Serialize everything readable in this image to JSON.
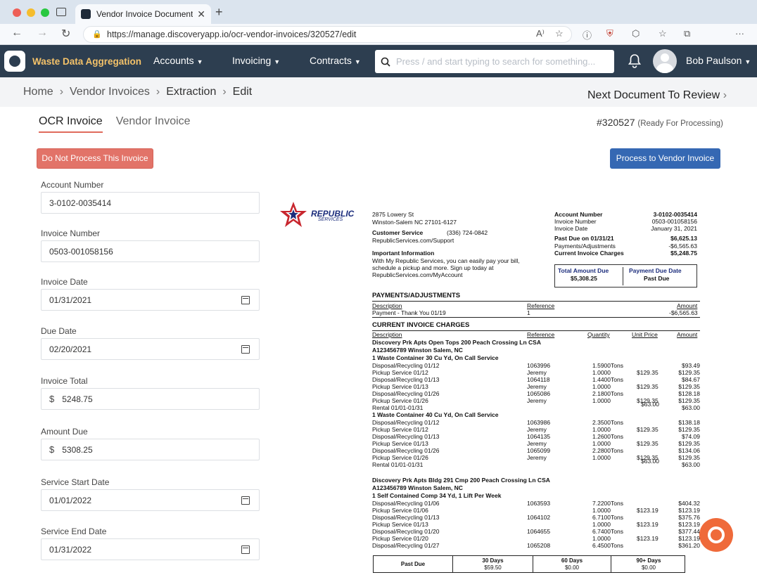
{
  "browser": {
    "tab_title": "Vendor Invoice Document Extr",
    "url": "https://manage.discoveryapp.io/ocr-vendor-invoices/320527/edit"
  },
  "app": {
    "brand": "Waste Data Aggregation",
    "menu": [
      "Accounts",
      "Invoicing",
      "Contracts"
    ],
    "search_placeholder": "Press / and start typing to search for something...",
    "user": "Bob Paulson"
  },
  "breadcrumb": [
    "Home",
    "Vendor Invoices",
    "Extraction",
    "Edit"
  ],
  "next_label": "Next Document To Review",
  "tabs": [
    "OCR Invoice",
    "Vendor Invoice"
  ],
  "doc_number": "#320527",
  "doc_status": "(Ready For Processing)",
  "buttons": {
    "reject": "Do Not Process This Invoice",
    "process": "Process to Vendor Invoice"
  },
  "fields": [
    {
      "label": "Account Number",
      "value": "3-0102-0035414"
    },
    {
      "label": "Invoice Number",
      "value": "0503-001058156"
    },
    {
      "label": "Invoice Date",
      "value": "01/31/2021"
    },
    {
      "label": "Due Date",
      "value": "02/20/2021"
    },
    {
      "label": "Invoice Total",
      "value": "5248.75",
      "currency": "$"
    },
    {
      "label": "Amount Due",
      "value": "5308.25",
      "currency": "$"
    },
    {
      "label": "Service Start Date",
      "value": "01/01/2022"
    },
    {
      "label": "Service End Date",
      "value": "01/31/2022"
    }
  ],
  "invoice": {
    "logo_name": "REPUBLIC",
    "logo_sub": "SERVICES",
    "address": [
      "2875 Lowery St",
      "Winston-Salem NC 27101-6127"
    ],
    "cs_label": "Customer Service",
    "cs_phone": "(336) 724-0842",
    "cs_url": "RepublicServices.com/Support",
    "info_title": "Important Information",
    "info_text": [
      "With My Republic Services, you can easily pay your bill,",
      "schedule a pickup and more. Sign up today at",
      "RepublicServices.com/MyAccount"
    ],
    "summary": [
      {
        "label": "Account Number",
        "value": "3-0102-0035414",
        "bold": true
      },
      {
        "label": "Invoice Number",
        "value": "0503-001058156",
        "bold": false
      },
      {
        "label": "Invoice Date",
        "value": "January 31, 2021",
        "bold": false
      },
      {
        "label": "Past Due on 01/31/21",
        "value": "$6,625.13",
        "bold": true
      },
      {
        "label": "Payments/Adjustments",
        "value": "-$6,565.63",
        "bold": false
      },
      {
        "label": "Current Invoice Charges",
        "value": "$5,248.75",
        "bold": true
      }
    ],
    "total_due_label": "Total Amount Due",
    "total_due_value": "$5,308.25",
    "pay_due_label": "Payment Due Date",
    "pay_due_value": "Past Due",
    "pay_adj_title": "PAYMENTS/ADJUSTMENTS",
    "pay_adj_headers": [
      "Description",
      "Reference",
      "Amount"
    ],
    "pay_adj_row": {
      "desc": "Payment - Thank You 01/19",
      "ref": "1",
      "amount": "-$6,565.63"
    },
    "charges_title": "CURRENT INVOICE CHARGES",
    "charges_headers": [
      "Description",
      "Reference",
      "Quantity",
      "Unit Price",
      "Amount"
    ],
    "groups": [
      {
        "site": "Discovery Prk Apts Open Tops  200 Peach Crossing Ln CSA",
        "acct": "A123456789 Winston Salem, NC",
        "blocks": [
          {
            "title": "1 Waste Container 30 Cu Yd, On Call Service",
            "rows": [
              [
                "Disposal/Recycling 01/12",
                "1063996",
                "1.5900Tons",
                "",
                "$93.49"
              ],
              [
                "Pickup Service 01/12",
                "Jeremy",
                "1.0000",
                "$129.35",
                "$129.35"
              ],
              [
                "Disposal/Recycling 01/13",
                "1064118",
                "1.4400Tons",
                "",
                "$84.67"
              ],
              [
                "Pickup Service 01/13",
                "Jeremy",
                "1.0000",
                "$129.35",
                "$129.35"
              ],
              [
                "Disposal/Recycling 01/26",
                "1065086",
                "2.1800Tons",
                "",
                "$128.18"
              ],
              [
                "Pickup Service 01/26",
                "Jeremy",
                "1.0000",
                "$129.35",
                "$129.35"
              ],
              [
                "Rental  01/01-01/31",
                "",
                "",
                "$63.00",
                "$63.00"
              ]
            ]
          },
          {
            "title": "1 Waste Container 40 Cu Yd, On Call Service",
            "rows": [
              [
                "Disposal/Recycling 01/12",
                "1063986",
                "2.3500Tons",
                "",
                "$138.18"
              ],
              [
                "Pickup Service 01/12",
                "Jeremy",
                "1.0000",
                "$129.35",
                "$129.35"
              ],
              [
                "Disposal/Recycling 01/13",
                "1064135",
                "1.2600Tons",
                "",
                "$74.09"
              ],
              [
                "Pickup Service 01/13",
                "Jeremy",
                "1.0000",
                "$129.35",
                "$129.35"
              ],
              [
                "Disposal/Recycling 01/26",
                "1065099",
                "2.2800Tons",
                "",
                "$134.06"
              ],
              [
                "Pickup Service 01/26",
                "Jeremy",
                "1.0000",
                "$129.35",
                "$129.35"
              ],
              [
                "Rental  01/01-01/31",
                "",
                "",
                "$63.00",
                "$63.00"
              ]
            ]
          }
        ]
      },
      {
        "site": "Discovery Prk Apts Bldg 291 Cmp  200 Peach Crossing Ln CSA",
        "acct": "A123456789 Winston Salem, NC",
        "blocks": [
          {
            "title": "1 Self Contained Comp 34 Yd, 1 Lift Per Week",
            "rows": [
              [
                "Disposal/Recycling 01/06",
                "1063593",
                "7.2200Tons",
                "",
                "$404.32"
              ],
              [
                "Pickup Service 01/06",
                "",
                "1.0000",
                "$123.19",
                "$123.19"
              ],
              [
                "Disposal/Recycling 01/13",
                "1064102",
                "6.7100Tons",
                "",
                "$375.76"
              ],
              [
                "Pickup Service 01/13",
                "",
                "1.0000",
                "$123.19",
                "$123.19"
              ],
              [
                "Disposal/Recycling 01/20",
                "1064655",
                "6.7400Tons",
                "",
                "$377.44"
              ],
              [
                "Pickup Service 01/20",
                "",
                "1.0000",
                "$123.19",
                "$123.19"
              ],
              [
                "Disposal/Recycling 01/27",
                "1065208",
                "6.4500Tons",
                "",
                "$361.20"
              ]
            ]
          }
        ]
      }
    ],
    "aging": [
      {
        "label": "Past Due",
        "value": ""
      },
      {
        "label": "30 Days",
        "value": "$59.50"
      },
      {
        "label": "60 Days",
        "value": "$0.00"
      },
      {
        "label": "90+ Days",
        "value": "$0.00"
      }
    ]
  }
}
